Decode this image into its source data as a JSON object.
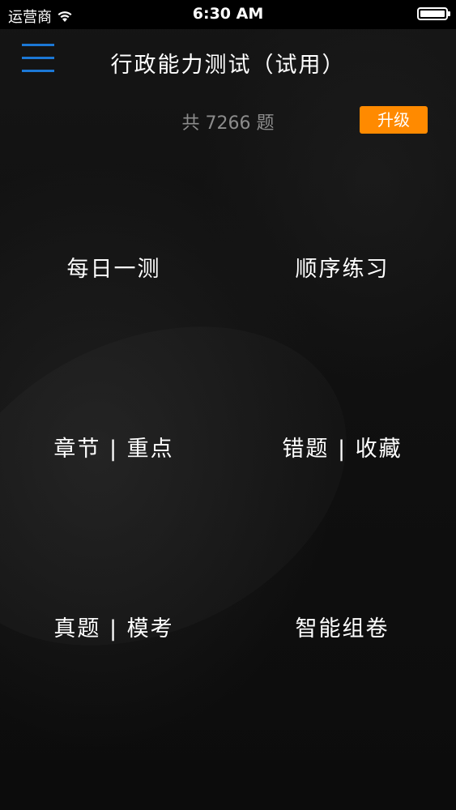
{
  "status_bar": {
    "carrier": "运营商",
    "time": "6:30 AM"
  },
  "nav": {
    "title": "行政能力测试（试用）"
  },
  "summary": {
    "count_text": "共 7266 题",
    "upgrade_label": "升级"
  },
  "menu": {
    "items": [
      {
        "label": "每日一测"
      },
      {
        "label": "顺序练习"
      },
      {
        "label": "章节 | 重点"
      },
      {
        "label": "错题 | 收藏"
      },
      {
        "label": "真题 | 模考"
      },
      {
        "label": "智能组卷"
      }
    ]
  },
  "colors": {
    "accent": "#1c78d6",
    "upgrade": "#ff8a00",
    "muted_text": "#8c8c8c"
  }
}
